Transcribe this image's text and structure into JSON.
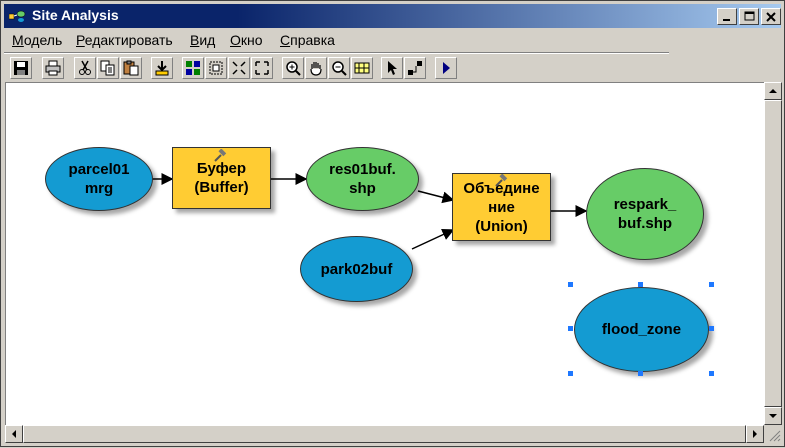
{
  "window": {
    "title": "Site Analysis",
    "title_icon": "model-icon"
  },
  "controls": {
    "minimize": "_",
    "maximize": "□",
    "close": "✕"
  },
  "menu": [
    {
      "label": "Модель",
      "underline": "М",
      "rest": "одель"
    },
    {
      "label": "Редактировать",
      "underline": "Р",
      "rest": "едактировать"
    },
    {
      "label": "Вид",
      "underline": "В",
      "rest": "ид"
    },
    {
      "label": "Окно",
      "underline": "О",
      "rest": "кно"
    },
    {
      "label": "Справка",
      "underline": "С",
      "rest": "правка"
    }
  ],
  "toolbar": [
    "save-icon",
    "print-icon",
    "cut-icon",
    "copy-icon",
    "paste-icon",
    "add-data-icon",
    "auto-layout-icon",
    "full-extent-icon",
    "zoom-in-fixed-icon",
    "zoom-out-fixed-icon",
    "zoom-in-icon",
    "pan-icon",
    "zoom-out-icon",
    "grid-icon",
    "select-icon",
    "connect-icon",
    "run-icon"
  ],
  "model": {
    "nodes": {
      "parcel": "parcel01\nmrg",
      "buffer": "Буфер\n(Buffer)",
      "res01": "res01buf.\nshp",
      "park": "park02buf",
      "union": "Объедине\nние\n(Union)",
      "respark": "respark_\nbuf.shp",
      "flood": "flood_zone"
    },
    "colors": {
      "input": "#149bd2",
      "output": "#67cc67",
      "tool": "#ffcc33",
      "selection": "#1e78ff"
    }
  }
}
